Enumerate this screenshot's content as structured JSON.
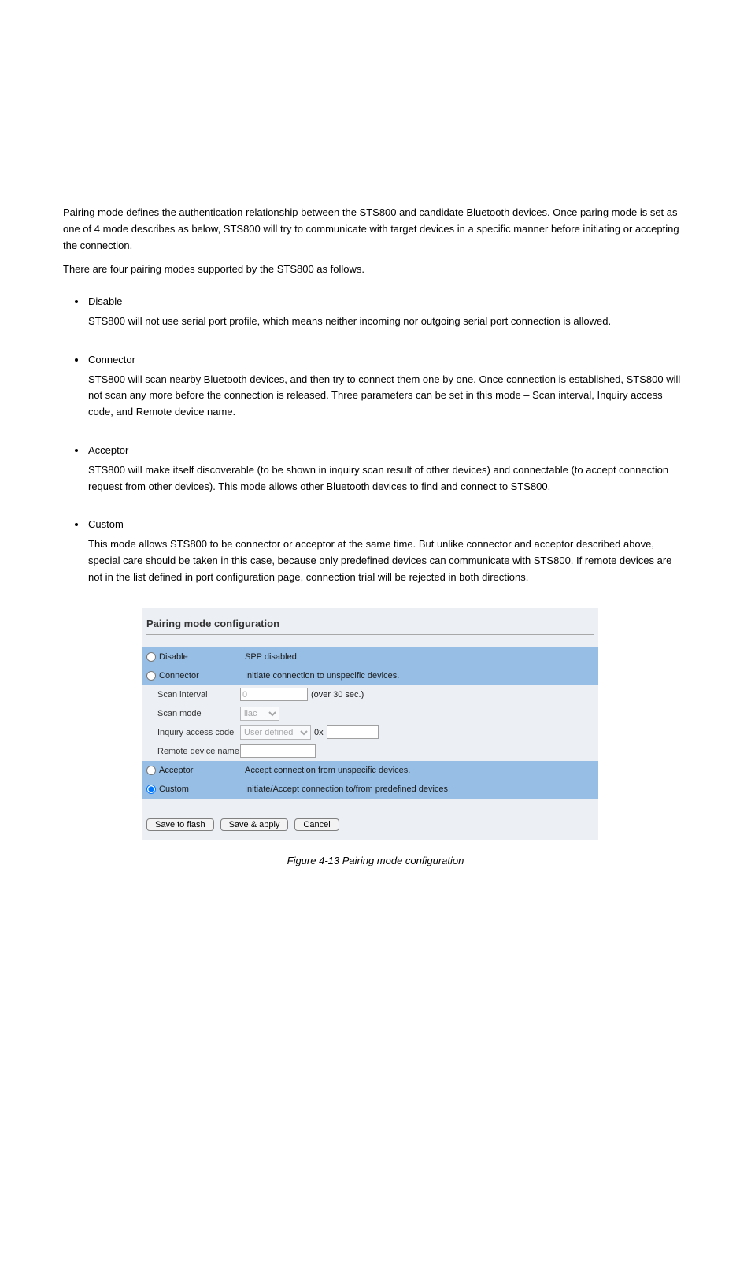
{
  "paragraphs": {
    "intro1": "Pairing mode defines the authentication relationship between the STS800 and candidate Bluetooth devices. Once paring mode is set as one of 4 mode describes as below, STS800 will try to communicate with target devices in a specific manner before initiating or accepting the connection.",
    "intro2": "There are four pairing modes supported by the STS800 as follows."
  },
  "modes": [
    {
      "name": "Disable",
      "body": "STS800 will not use serial port profile, which means neither incoming nor outgoing serial port connection is allowed."
    },
    {
      "name": "Connector",
      "body": "STS800 will scan nearby Bluetooth devices, and then try to connect them one by one. Once connection is established, STS800 will not scan any more before the connection is released. Three parameters can be set in this mode – Scan interval, Inquiry access code, and Remote device name."
    },
    {
      "name": "Acceptor",
      "body": "STS800 will make itself discoverable (to be shown in inquiry scan result of other devices) and connectable (to accept connection request from other devices). This mode allows other Bluetooth devices to find and connect to STS800."
    },
    {
      "name": "Custom",
      "body": "This mode allows STS800 to be connector or acceptor at the same time. But unlike connector and acceptor described above, special care should be taken in this case, because only predefined devices can communicate with STS800. If remote devices are not in the list defined in port configuration page, connection trial will be rejected in both directions."
    }
  ],
  "panel": {
    "title": "Pairing mode configuration",
    "options": {
      "disable": {
        "label": "Disable",
        "desc": "SPP disabled."
      },
      "connector": {
        "label": "Connector",
        "desc": "Initiate connection to unspecific devices."
      },
      "acceptor": {
        "label": "Acceptor",
        "desc": "Accept connection from unspecific devices."
      },
      "custom": {
        "label": "Custom",
        "desc": "Initiate/Accept connection to/from predefined devices."
      }
    },
    "fields": {
      "scan_interval_label": "Scan interval",
      "scan_interval_value": "0",
      "scan_interval_hint": "(over 30 sec.)",
      "scan_mode_label": "Scan mode",
      "scan_mode_value": "liac",
      "iac_label": "Inquiry access code",
      "iac_value": "User defined",
      "iac_prefix": "0x",
      "iac_hex": "",
      "remote_name_label": "Remote device name",
      "remote_name_value": ""
    },
    "buttons": {
      "save_flash": "Save to flash",
      "save_apply": "Save & apply",
      "cancel": "Cancel"
    }
  },
  "figure_caption": "Figure 4-13 Pairing mode configuration"
}
